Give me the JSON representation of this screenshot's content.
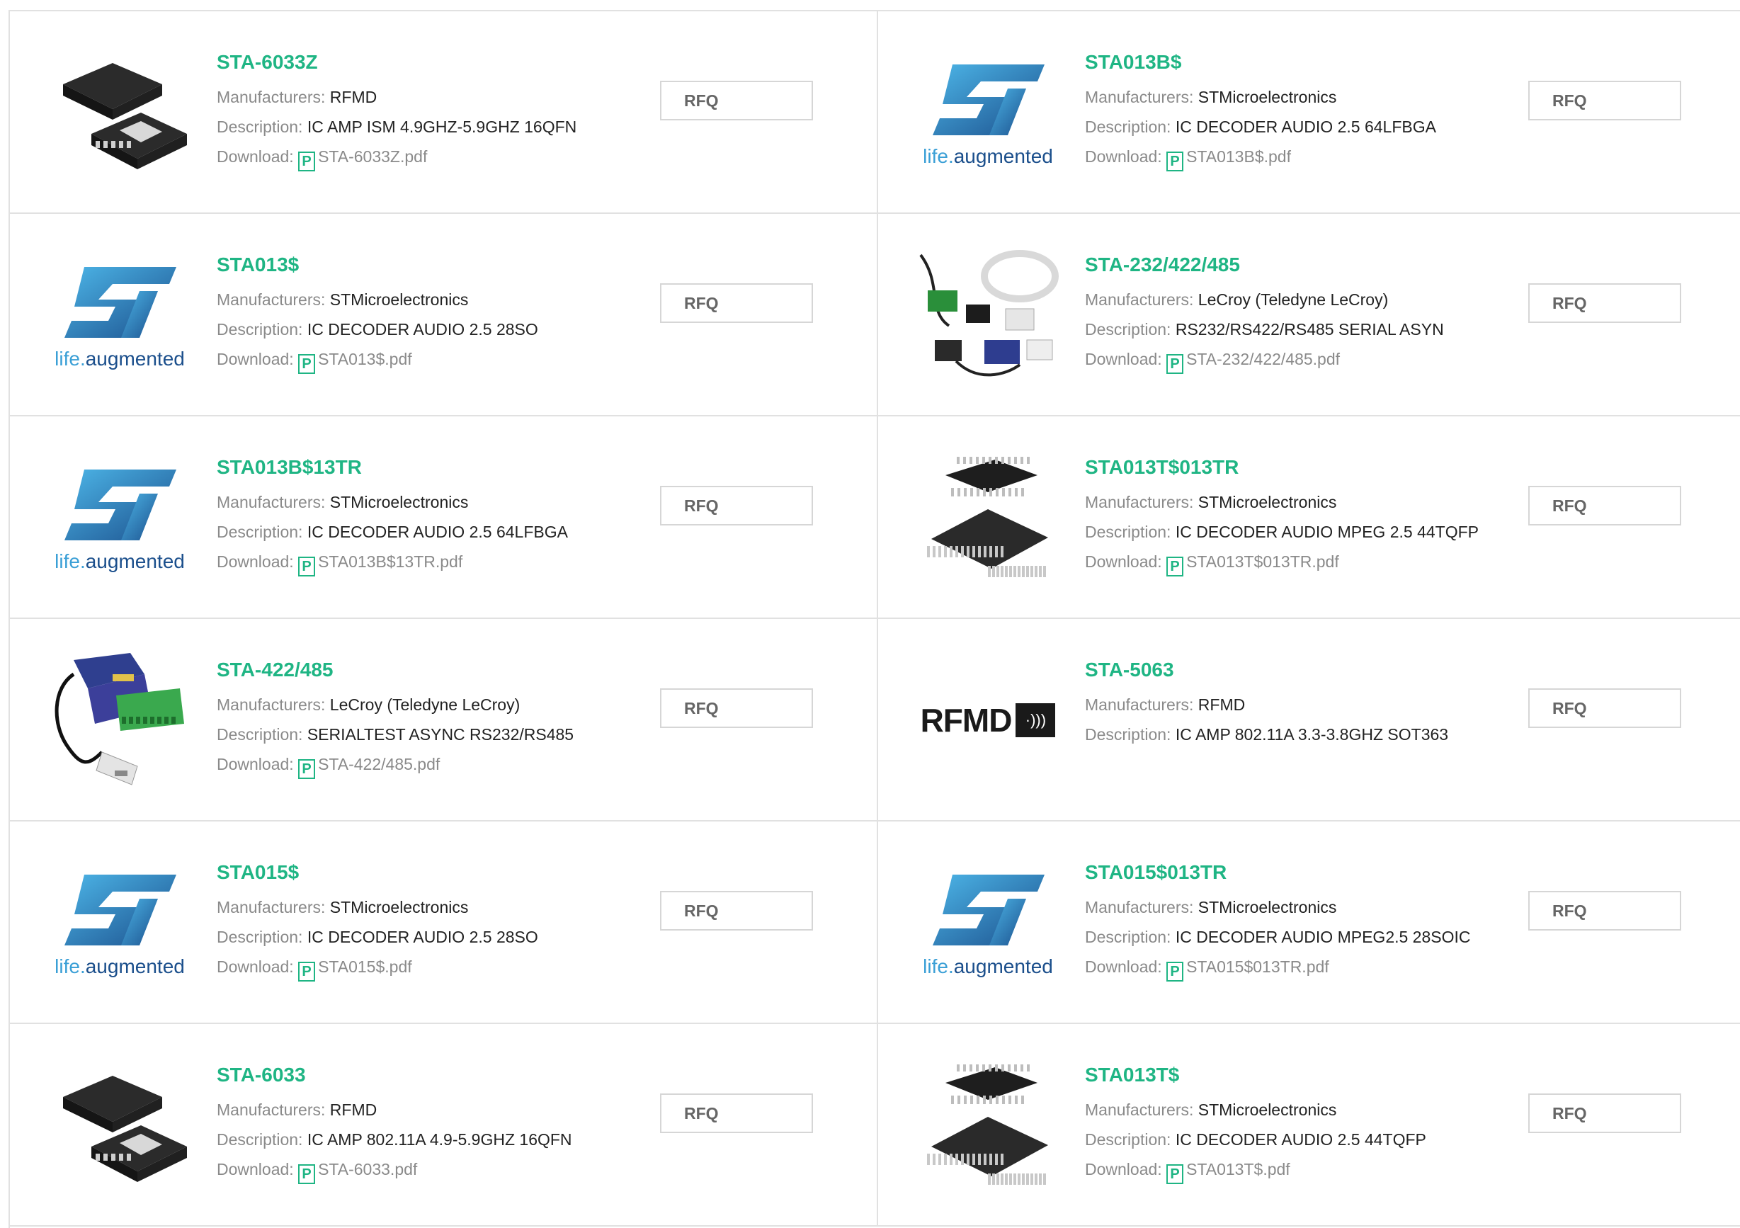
{
  "labels": {
    "manufacturers": "Manufacturers:",
    "description": "Description:",
    "download": "Download:",
    "rfq": "RFQ",
    "pdf_icon": "P"
  },
  "colors": {
    "accent": "#1fb584",
    "st_blue": "#1b4f8c",
    "st_light": "#3a9fd6"
  },
  "items": [
    {
      "part": "STA-6033Z",
      "manufacturer": "RFMD",
      "description": "IC AMP ISM 4.9GHZ-5.9GHZ 16QFN",
      "file": "STA-6033Z.pdf",
      "thumbnail": "qfn-chip"
    },
    {
      "part": "STA013B$",
      "manufacturer": "STMicroelectronics",
      "description": "IC DECODER AUDIO 2.5 64LFBGA",
      "file": "STA013B$.pdf",
      "thumbnail": "st-logo"
    },
    {
      "part": "STA013$",
      "manufacturer": "STMicroelectronics",
      "description": "IC DECODER AUDIO 2.5 28SO",
      "file": "STA013$.pdf",
      "thumbnail": "st-logo"
    },
    {
      "part": "STA-232/422/485",
      "manufacturer": "LeCroy (Teledyne LeCroy)",
      "description": "RS232/RS422/RS485 SERIAL ASYN",
      "file": "STA-232/422/485.pdf",
      "thumbnail": "cable-kit"
    },
    {
      "part": "STA013B$13TR",
      "manufacturer": "STMicroelectronics",
      "description": "IC DECODER AUDIO 2.5 64LFBGA",
      "file": "STA013B$13TR.pdf",
      "thumbnail": "st-logo"
    },
    {
      "part": "STA013T$013TR",
      "manufacturer": "STMicroelectronics",
      "description": "IC DECODER AUDIO MPEG 2.5 44TQFP",
      "file": "STA013T$013TR.pdf",
      "thumbnail": "tqfp-chip"
    },
    {
      "part": "STA-422/485",
      "manufacturer": "LeCroy (Teledyne LeCroy)",
      "description": "SERIALTEST ASYNC RS232/RS485",
      "file": "STA-422/485.pdf",
      "thumbnail": "usb-adapter"
    },
    {
      "part": "STA-5063",
      "manufacturer": "RFMD",
      "description": "IC AMP 802.11A 3.3-3.8GHZ SOT363",
      "file": null,
      "thumbnail": "rfmd-logo"
    },
    {
      "part": "STA015$",
      "manufacturer": "STMicroelectronics",
      "description": "IC DECODER AUDIO 2.5 28SO",
      "file": "STA015$.pdf",
      "thumbnail": "st-logo"
    },
    {
      "part": "STA015$013TR",
      "manufacturer": "STMicroelectronics",
      "description": "IC DECODER AUDIO MPEG2.5 28SOIC",
      "file": "STA015$013TR.pdf",
      "thumbnail": "st-logo"
    },
    {
      "part": "STA-6033",
      "manufacturer": "RFMD",
      "description": "IC AMP 802.11A 4.9-5.9GHZ 16QFN",
      "file": "STA-6033.pdf",
      "thumbnail": "qfn-chip"
    },
    {
      "part": "STA013T$",
      "manufacturer": "STMicroelectronics",
      "description": "IC DECODER AUDIO 2.5 44TQFP",
      "file": "STA013T$.pdf",
      "thumbnail": "tqfp-chip"
    }
  ],
  "thumbnail_text": {
    "st_tagline_a": "life.",
    "st_tagline_b": "augmented",
    "rfmd_name": "RFMD",
    "rfmd_mark": "·)))"
  }
}
